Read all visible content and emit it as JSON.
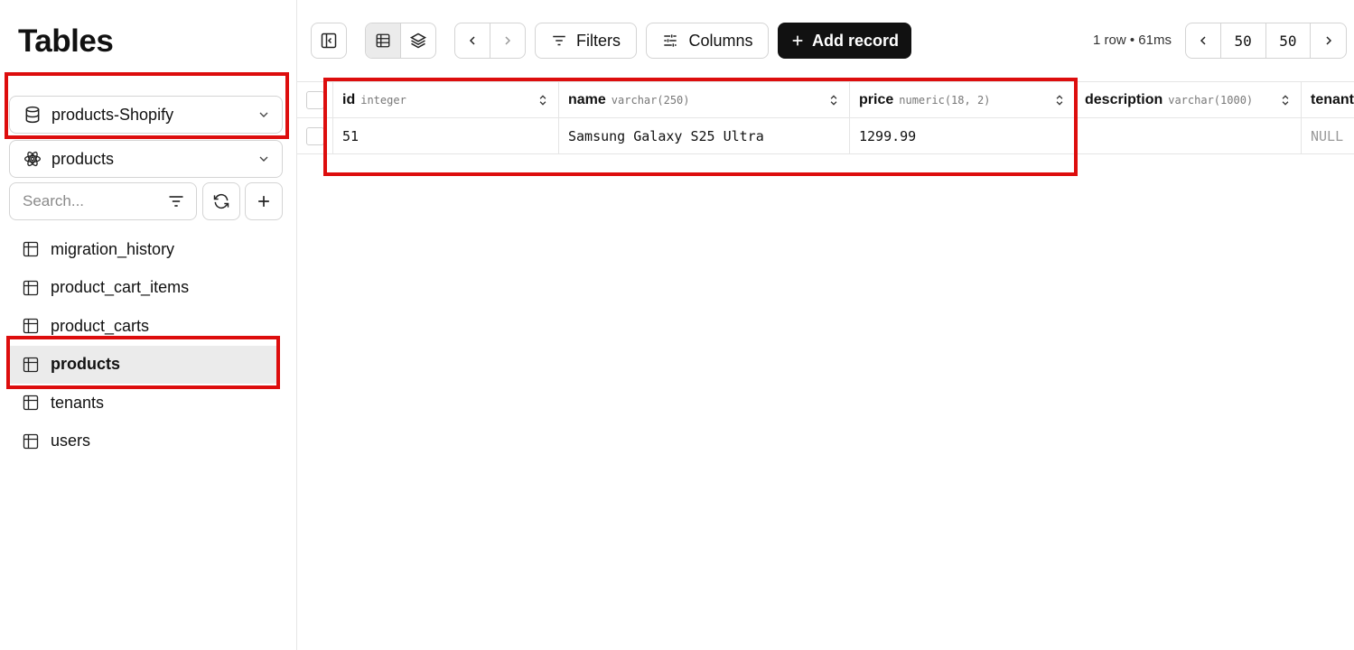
{
  "sidebar": {
    "title": "Tables",
    "database_select": {
      "value": "products-Shopify"
    },
    "schema_select": {
      "value": "products"
    },
    "search": {
      "placeholder": "Search..."
    },
    "tables": [
      {
        "label": "migration_history",
        "active": false
      },
      {
        "label": "product_cart_items",
        "active": false
      },
      {
        "label": "product_carts",
        "active": false
      },
      {
        "label": "products",
        "active": true
      },
      {
        "label": "tenants",
        "active": false
      },
      {
        "label": "users",
        "active": false
      }
    ]
  },
  "toolbar": {
    "filters_label": "Filters",
    "columns_label": "Columns",
    "add_record_label": "Add record",
    "status": "1 row • 61ms",
    "page_number": "50",
    "page_size": "50"
  },
  "grid": {
    "columns": [
      {
        "name": "id",
        "type": "integer"
      },
      {
        "name": "name",
        "type": "varchar(250)"
      },
      {
        "name": "price",
        "type": "numeric(18, 2)"
      },
      {
        "name": "description",
        "type": "varchar(1000)"
      },
      {
        "name": "tenant",
        "type": ""
      }
    ],
    "rows": [
      {
        "id": "51",
        "name": "Samsung Galaxy S25 Ultra",
        "price": "1299.99",
        "description": "",
        "tenant": "NULL"
      }
    ]
  },
  "colors": {
    "accent_dark": "#111111",
    "highlight_red": "#dd0d0d",
    "active_row_bg": "#ebebeb",
    "border": "#d4d4d4"
  }
}
